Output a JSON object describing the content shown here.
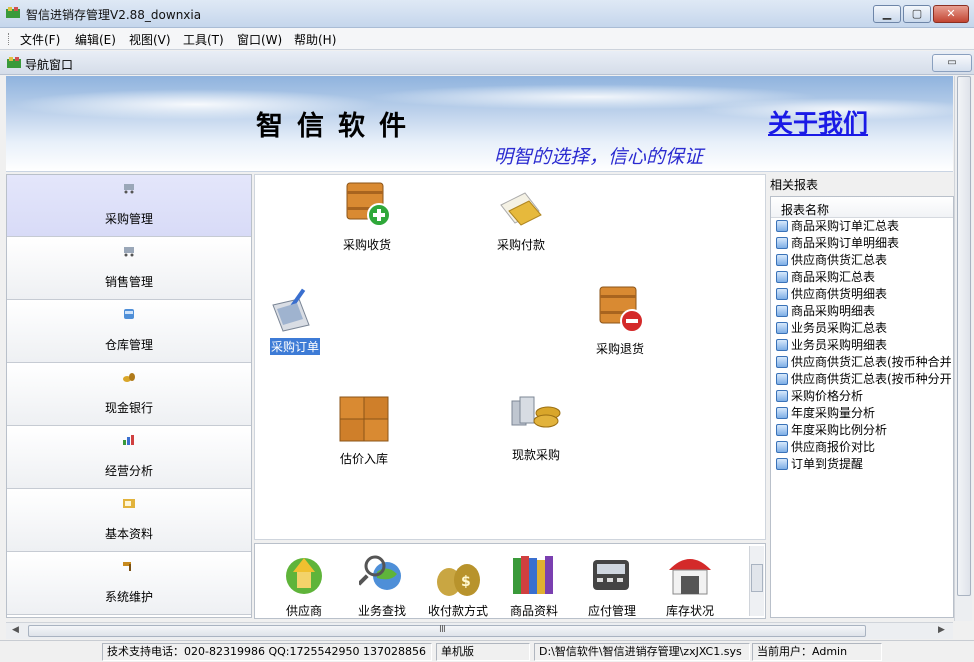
{
  "window": {
    "title": "智信进销存管理V2.88_downxia",
    "min": "▁",
    "max": "▢",
    "close": "✕"
  },
  "menu": [
    "文件(F)",
    "编辑(E)",
    "视图(V)",
    "工具(T)",
    "窗口(W)",
    "帮助(H)"
  ],
  "child_window": {
    "title": "导航窗口",
    "restore": "▭"
  },
  "banner": {
    "brand": "智信软件",
    "about": "关于我们",
    "slogan": "明智的选择，信心的保证"
  },
  "nav": [
    {
      "label": "采购管理",
      "icon": "cart-icon",
      "active": true
    },
    {
      "label": "销售管理",
      "icon": "cart-icon"
    },
    {
      "label": "仓库管理",
      "icon": "box-icon"
    },
    {
      "label": "现金银行",
      "icon": "money-icon"
    },
    {
      "label": "经营分析",
      "icon": "chart-icon"
    },
    {
      "label": "基本资料",
      "icon": "folder-icon"
    },
    {
      "label": "系统维护",
      "icon": "hammer-icon"
    }
  ],
  "tiles": {
    "receive": "采购收货",
    "payment": "采购付款",
    "order": "采购订单",
    "return": "采购退货",
    "estimate": "估价入库",
    "cash_purchase": "现款采购"
  },
  "strip": [
    "供应商",
    "业务查找",
    "收付款方式",
    "商品资料",
    "应付管理",
    "库存状况"
  ],
  "reports": {
    "title": "相关报表",
    "header": "报表名称",
    "items": [
      "商品采购订单汇总表",
      "商品采购订单明细表",
      "供应商供货汇总表",
      "商品采购汇总表",
      "供应商供货明细表",
      "商品采购明细表",
      "业务员采购汇总表",
      "业务员采购明细表",
      "供应商供货汇总表(按币种合并",
      "供应商供货汇总表(按币种分开",
      "采购价格分析",
      "年度采购量分析",
      "年度采购比例分析",
      "供应商报价对比",
      "订单到货提醒"
    ]
  },
  "hscroll": {
    "center": "Ⅲ"
  },
  "status": {
    "support": "技术支持电话：020-82319986 QQ:1725542950 137028856",
    "edition": "单机版",
    "path": "D:\\智信软件\\智信进销存管理\\zxJXC1.sys",
    "user": "当前用户：Admin"
  },
  "colors": {
    "accent": "#3d7bd6",
    "banner_link": "#1a1ae6",
    "slogan": "#2a2ad0"
  }
}
